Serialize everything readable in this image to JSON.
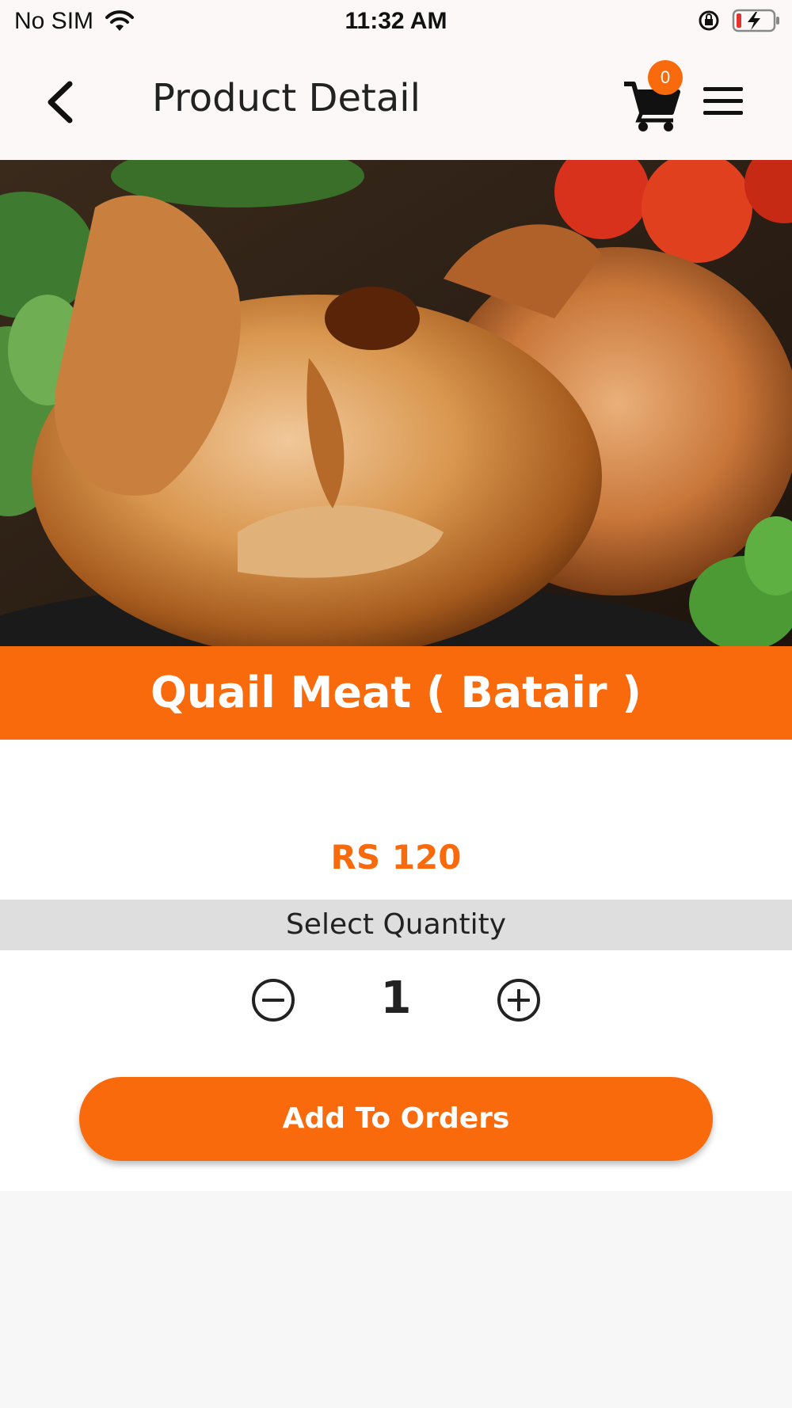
{
  "status_bar": {
    "carrier": "No SIM",
    "time": "11:32 AM",
    "icons": [
      "wifi-icon",
      "orientation-lock-icon",
      "battery-charging-icon"
    ]
  },
  "header": {
    "title": "Product Detail",
    "back_icon": "chevron-left-icon",
    "cart_icon": "cart-icon",
    "cart_count": "0",
    "menu_icon": "hamburger-menu-icon"
  },
  "product": {
    "image": "roasted-quail-photo",
    "name": "Quail Meat ( Batair )",
    "price": "RS 120"
  },
  "quantity": {
    "label": "Select Quantity",
    "value": "1",
    "minus_icon": "minus-circle-icon",
    "plus_icon": "plus-circle-icon"
  },
  "actions": {
    "add_label": "Add To Orders"
  },
  "colors": {
    "accent": "#f96a0c",
    "header_bg": "#fcf8f8",
    "qty_bar_bg": "#dedede"
  }
}
